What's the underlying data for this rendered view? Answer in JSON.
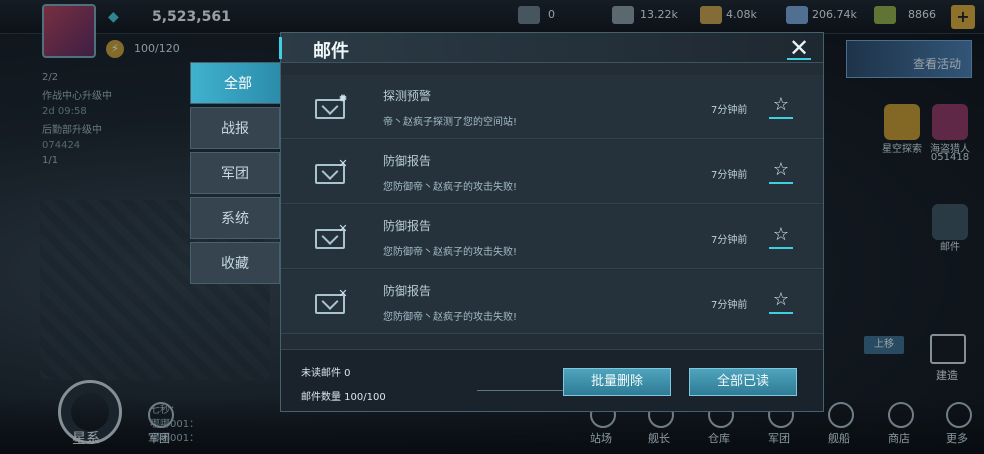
{
  "hud": {
    "power": "5,523,561",
    "energy": "100/120",
    "resources": [
      {
        "value": "0",
        "color": "#6b7f8a"
      },
      {
        "value": "13.22k",
        "color": "#8b9ba5"
      },
      {
        "value": "4.08k",
        "color": "#c6a24a"
      },
      {
        "value": "206.74k",
        "color": "#7aa8d8"
      },
      {
        "value": "8866",
        "color": "#8fae4a"
      }
    ],
    "plus_label": "+"
  },
  "left_panel": [
    {
      "text": "2/2",
      "style": "normal"
    },
    {
      "text": "作战中心升级中",
      "style": "normal"
    },
    {
      "text": "2d 09:58",
      "style": "small"
    },
    {
      "text": "后勤部升级中",
      "style": "normal"
    },
    {
      "text": "074424",
      "style": "small"
    },
    {
      "text": "1/1",
      "style": "normal"
    }
  ],
  "event_banner": "查看活动",
  "side_buttons": [
    {
      "label": "星空探索",
      "color": "#c79a32"
    },
    {
      "label": "海盗猎人",
      "color": "#8f3a66"
    },
    {
      "label": "邮件",
      "color": "#3c5563"
    }
  ],
  "side_sub": "051418",
  "up_label": "上移",
  "build_label": "建造",
  "galaxy_label": "星系",
  "chat": [
    "七秒：",
    "哪哪001：",
    "哪哪001："
  ],
  "bottom_nav": [
    "军团",
    "站场",
    "舰长",
    "仓库",
    "军团",
    "舰船",
    "商店",
    "更多"
  ],
  "mail": {
    "title": "邮件",
    "tabs": [
      "全部",
      "战报",
      "军团",
      "系统",
      "收藏"
    ],
    "active_tab": 0,
    "items": [
      {
        "icon": "gear-badge",
        "title": "探测预警",
        "body": "帝丶赵疯子探测了您的空间站!",
        "time": "7分钟前"
      },
      {
        "icon": "x-badge",
        "title": "防御报告",
        "body": "您防御帝丶赵疯子的攻击失败!",
        "time": "7分钟前"
      },
      {
        "icon": "x-badge",
        "title": "防御报告",
        "body": "您防御帝丶赵疯子的攻击失败!",
        "time": "7分钟前"
      },
      {
        "icon": "x-badge",
        "title": "防御报告",
        "body": "您防御帝丶赵疯子的攻击失败!",
        "time": "7分钟前"
      }
    ],
    "unread_label": "未读邮件 0",
    "count_label": "邮件数量 100/100",
    "batch_delete_label": "批量删除",
    "mark_all_read_label": "全部已读",
    "accent_color": "#3ed0e0"
  }
}
